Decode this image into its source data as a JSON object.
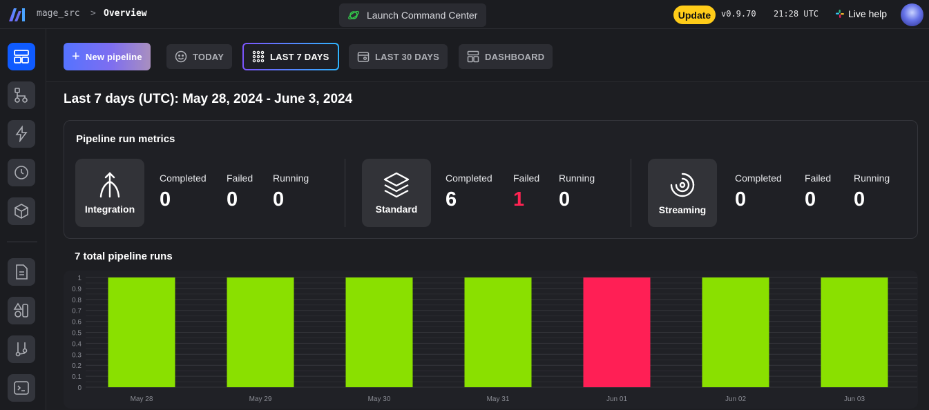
{
  "header": {
    "breadcrumb_project": "mage_src",
    "breadcrumb_separator": ">",
    "breadcrumb_page": "Overview",
    "launch_label": "Launch Command Center",
    "update_label": "Update",
    "version": "v0.9.70",
    "time": "21:28 UTC",
    "live_help": "Live help",
    "colors": {
      "brand_blue": "#0f5bff",
      "update_yellow": "#ffcc19"
    }
  },
  "sidebar": {
    "items": [
      {
        "icon": "overview-icon",
        "active": true
      },
      {
        "icon": "pipelines-icon"
      },
      {
        "icon": "triggers-icon"
      },
      {
        "icon": "pipeline-runs-icon"
      },
      {
        "icon": "global-data-products-icon"
      },
      {
        "icon": "files-icon"
      },
      {
        "icon": "templates-icon"
      },
      {
        "icon": "version-control-icon"
      },
      {
        "icon": "terminal-icon"
      }
    ]
  },
  "tabs": {
    "new_pipeline": "New pipeline",
    "today": "TODAY",
    "last_7_days": "LAST 7 DAYS",
    "last_30_days": "LAST 30 DAYS",
    "dashboard": "DASHBOARD",
    "selected": "LAST 7 DAYS"
  },
  "main": {
    "title": "Last 7 days (UTC): May 28, 2024 - June 3, 2024",
    "metrics": {
      "title": "Pipeline run metrics",
      "groups": [
        {
          "name": "Integration",
          "completed_label": "Completed",
          "completed": "0",
          "failed_label": "Failed",
          "failed": "0",
          "running_label": "Running",
          "running": "0"
        },
        {
          "name": "Standard",
          "completed_label": "Completed",
          "completed": "6",
          "failed_label": "Failed",
          "failed": "1",
          "running_label": "Running",
          "running": "0"
        },
        {
          "name": "Streaming",
          "completed_label": "Completed",
          "completed": "0",
          "failed_label": "Failed",
          "failed": "0",
          "running_label": "Running",
          "running": "0"
        }
      ]
    },
    "runs_title": "7 total pipeline runs"
  },
  "chart_data": {
    "type": "bar",
    "categories": [
      "May 28",
      "May 29",
      "May 30",
      "May 31",
      "Jun 01",
      "Jun 02",
      "Jun 03"
    ],
    "values": [
      1,
      1,
      1,
      1,
      1,
      1,
      1
    ],
    "statuses": [
      "completed",
      "completed",
      "completed",
      "completed",
      "failed",
      "completed",
      "completed"
    ],
    "colors": {
      "completed": "#8ae000",
      "failed": "#ff1f55"
    },
    "ylim": [
      0,
      1
    ],
    "yticks": [
      "0",
      "0.1",
      "0.2",
      "0.3",
      "0.4",
      "0.5",
      "0.6",
      "0.7",
      "0.8",
      "0.9",
      "1"
    ],
    "grid": true
  }
}
